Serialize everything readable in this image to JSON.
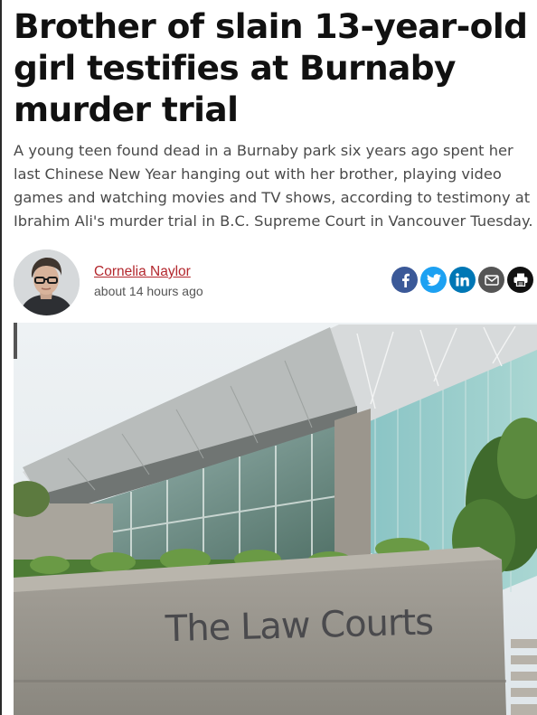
{
  "article": {
    "headline": "Brother of slain 13-year-old girl testifies at Burnaby murder trial",
    "dek": "A young teen found dead in a Burnaby park six years ago spent her last Chinese New Year hanging out with her brother, playing video games and watching movies and TV shows, according to testimony at Ibrahim Ali's murder trial in B.C. Supreme Court in Vancouver Tuesday."
  },
  "byline": {
    "author": "Cornelia Naylor",
    "timestamp": "about 14 hours ago"
  },
  "share": [
    {
      "name": "facebook",
      "icon": "facebook-icon",
      "color": "#3b5998"
    },
    {
      "name": "twitter",
      "icon": "twitter-icon",
      "color": "#1da1f2"
    },
    {
      "name": "linkedin",
      "icon": "linkedin-icon",
      "color": "#0077b5"
    },
    {
      "name": "email",
      "icon": "envelope-icon",
      "color": "#555555"
    },
    {
      "name": "print",
      "icon": "printer-icon",
      "color": "#111111"
    }
  ],
  "photo": {
    "sign_text": "The Law Courts"
  },
  "colors": {
    "author_link": "#b3272d",
    "headline": "#111111",
    "dek": "#4a4a4a"
  }
}
